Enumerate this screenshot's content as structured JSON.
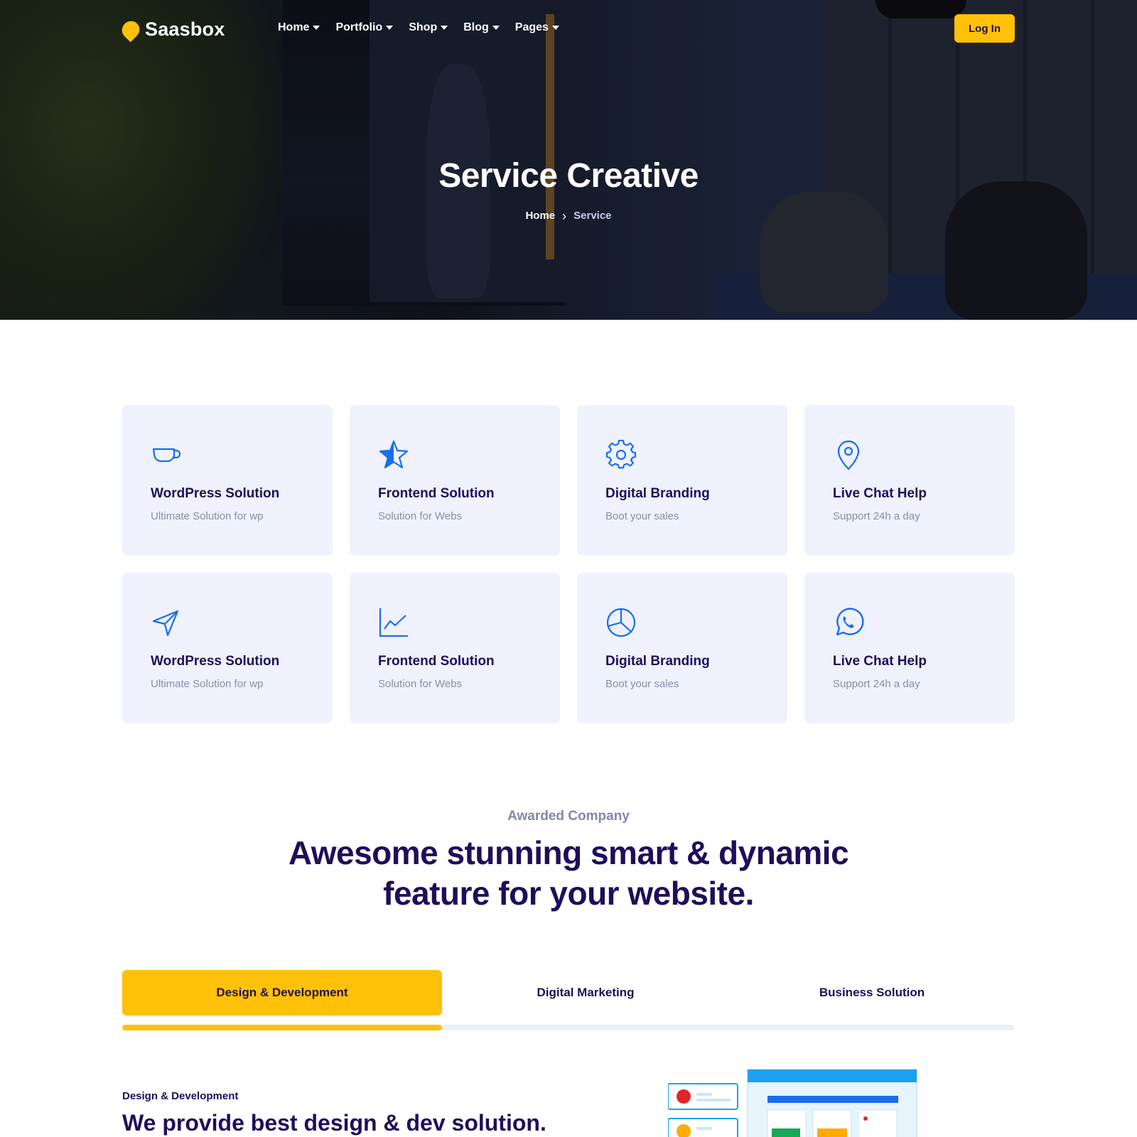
{
  "brand": {
    "name": "Saasbox",
    "logo_color": "#ffc107"
  },
  "nav": {
    "items": [
      {
        "label": "Home"
      },
      {
        "label": "Portfolio"
      },
      {
        "label": "Shop"
      },
      {
        "label": "Blog"
      },
      {
        "label": "Pages"
      }
    ],
    "login_label": "Log In"
  },
  "hero": {
    "title": "Service Creative",
    "breadcrumb": {
      "home": "Home",
      "separator": "›",
      "current": "Service"
    }
  },
  "services": [
    {
      "icon": "cup-icon",
      "title": "WordPress Solution",
      "subtitle": "Ultimate Solution for wp"
    },
    {
      "icon": "star-icon",
      "title": "Frontend Solution",
      "subtitle": "Solution for Webs"
    },
    {
      "icon": "gear-icon",
      "title": "Digital Branding",
      "subtitle": "Boot your sales"
    },
    {
      "icon": "map-pin-icon",
      "title": "Live Chat Help",
      "subtitle": "Support 24h a day"
    },
    {
      "icon": "send-icon",
      "title": "WordPress Solution",
      "subtitle": "Ultimate Solution for wp"
    },
    {
      "icon": "line-chart-icon",
      "title": "Frontend Solution",
      "subtitle": "Solution for Webs"
    },
    {
      "icon": "pie-chart-icon",
      "title": "Digital Branding",
      "subtitle": "Boot your sales"
    },
    {
      "icon": "whatsapp-icon",
      "title": "Live Chat Help",
      "subtitle": "Support 24h a day"
    }
  ],
  "feature": {
    "eyebrow": "Awarded Company",
    "headline_line1": "Awesome stunning smart & dynamic",
    "headline_line2": "feature for your website."
  },
  "tabs": {
    "items": [
      {
        "label": "Design & Development",
        "active": true
      },
      {
        "label": "Digital Marketing",
        "active": false
      },
      {
        "label": "Business Solution",
        "active": false
      }
    ],
    "progress": 0.358
  },
  "tab_content": {
    "eyebrow": "Design & Development",
    "title": "We provide best design & dev solution."
  },
  "colors": {
    "accent": "#ffc107",
    "primary_text": "#1f0e59",
    "icon_blue": "#1a6cf0",
    "card_bg": "#eff2fc",
    "muted_text": "#8a8ca8"
  }
}
